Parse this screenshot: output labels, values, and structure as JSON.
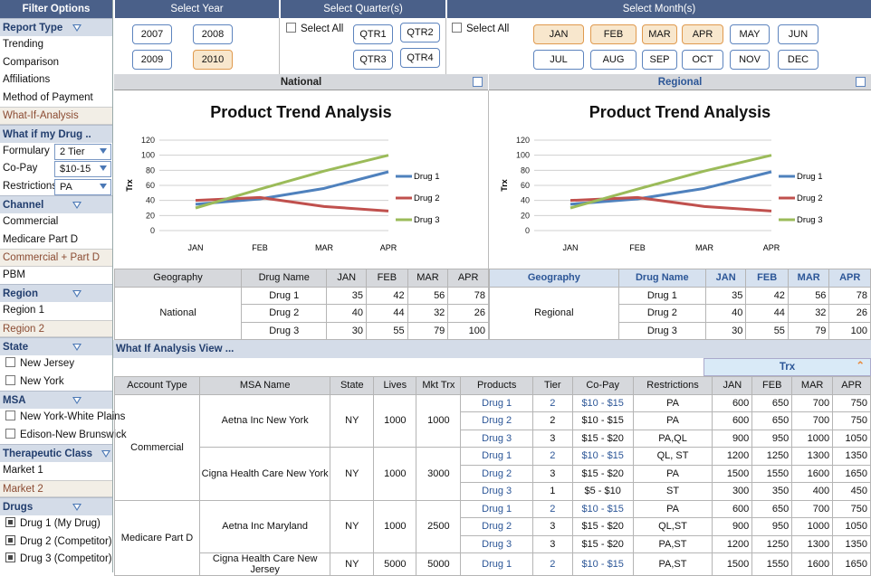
{
  "sidebar": {
    "title": "Filter Options",
    "report_type": {
      "header": "Report Type",
      "items": [
        "Trending",
        "Comparison",
        "Affiliations",
        "Method of Payment",
        "What-If-Analysis"
      ]
    },
    "what_if": {
      "header": "What if my Drug ..",
      "rows": [
        {
          "label": "Formulary",
          "value": "2 Tier"
        },
        {
          "label": "Co-Pay",
          "value": "$10-15"
        },
        {
          "label": "Restrictions",
          "value": "PA"
        }
      ]
    },
    "channel": {
      "header": "Channel",
      "items": [
        "Commercial",
        "Medicare Part D",
        "Commercial + Part D",
        "PBM"
      ]
    },
    "region": {
      "header": "Region",
      "items": [
        "Region 1",
        "Region 2"
      ]
    },
    "state": {
      "header": "State",
      "items": [
        "New Jersey",
        "New York"
      ]
    },
    "msa": {
      "header": "MSA",
      "items": [
        "New York-White Plains",
        "Edison-New Brunswick"
      ]
    },
    "therapeutic": {
      "header": "Therapeutic Class",
      "items": [
        "Market 1",
        "Market 2"
      ]
    },
    "drugs": {
      "header": "Drugs",
      "items": [
        "Drug 1 (My Drug)",
        "Drug 2 (Competitor)",
        "Drug 3 (Competitor)"
      ]
    }
  },
  "filters": {
    "year": {
      "header": "Select Year",
      "options": [
        "2007",
        "2008",
        "2009",
        "2010"
      ],
      "selected": "2010"
    },
    "quarter": {
      "header": "Select Quarter(s)",
      "select_all": "Select All",
      "options": [
        "QTR1",
        "QTR2",
        "QTR3",
        "QTR4"
      ]
    },
    "month": {
      "header": "Select Month(s)",
      "select_all": "Select All",
      "options": [
        "JAN",
        "FEB",
        "MAR",
        "APR",
        "MAY",
        "JUN",
        "JUL",
        "AUG",
        "SEP",
        "OCT",
        "NOV",
        "DEC"
      ],
      "selected": [
        "JAN",
        "FEB",
        "MAR",
        "APR"
      ]
    }
  },
  "panels": {
    "national": "National",
    "regional": "Regional"
  },
  "chart_data": [
    {
      "type": "line",
      "title": "Product Trend Analysis",
      "ylabel": "Trx",
      "xlabel": "",
      "categories": [
        "JAN",
        "FEB",
        "MAR",
        "APR"
      ],
      "ylim": [
        0,
        120
      ],
      "yticks": [
        0,
        20,
        40,
        60,
        80,
        100,
        120
      ],
      "grid": true,
      "legend": "right",
      "series": [
        {
          "name": "Drug 1",
          "values": [
            35,
            42,
            56,
            78
          ],
          "color": "#4f81bd"
        },
        {
          "name": "Drug 2",
          "values": [
            40,
            44,
            32,
            26
          ],
          "color": "#c0504d"
        },
        {
          "name": "Drug 3",
          "values": [
            30,
            55,
            79,
            100
          ],
          "color": "#9bbb59"
        }
      ]
    },
    {
      "type": "line",
      "title": "Product Trend Analysis",
      "ylabel": "Trx",
      "xlabel": "",
      "categories": [
        "JAN",
        "FEB",
        "MAR",
        "APR"
      ],
      "ylim": [
        0,
        120
      ],
      "yticks": [
        0,
        20,
        40,
        60,
        80,
        100,
        120
      ],
      "grid": true,
      "legend": "right",
      "series": [
        {
          "name": "Drug 1",
          "values": [
            35,
            42,
            56,
            78
          ],
          "color": "#4f81bd"
        },
        {
          "name": "Drug 2",
          "values": [
            40,
            44,
            32,
            26
          ],
          "color": "#c0504d"
        },
        {
          "name": "Drug 3",
          "values": [
            30,
            55,
            79,
            100
          ],
          "color": "#9bbb59"
        }
      ]
    }
  ],
  "summary": {
    "headers": [
      "Geography",
      "Drug Name",
      "JAN",
      "FEB",
      "MAR",
      "APR"
    ],
    "national": {
      "geo": "National",
      "rows": [
        [
          "Drug 1",
          "35",
          "42",
          "56",
          "78"
        ],
        [
          "Drug 2",
          "40",
          "44",
          "32",
          "26"
        ],
        [
          "Drug 3",
          "30",
          "55",
          "79",
          "100"
        ]
      ]
    },
    "regional": {
      "geo": "Regional",
      "rows": [
        [
          "Drug 1",
          "35",
          "42",
          "56",
          "78"
        ],
        [
          "Drug 2",
          "40",
          "44",
          "32",
          "26"
        ],
        [
          "Drug 3",
          "30",
          "55",
          "79",
          "100"
        ]
      ]
    }
  },
  "whatif": {
    "title": "What If Analysis View ...",
    "trx": "Trx",
    "headers": [
      "Account Type",
      "MSA Name",
      "State",
      "Lives",
      "Mkt Trx",
      "Products",
      "Tier",
      "Co-Pay",
      "Restrictions",
      "JAN",
      "FEB",
      "MAR",
      "APR"
    ],
    "groups": [
      {
        "account": "Commercial",
        "msas": [
          {
            "name": "Aetna Inc New York",
            "state": "NY",
            "lives": "1000",
            "mkt": "1000",
            "rows": [
              [
                "Drug 1",
                "2",
                "$10 - $15",
                "PA",
                "600",
                "650",
                "700",
                "750"
              ],
              [
                "Drug 2",
                "2",
                "$10 - $15",
                "PA",
                "600",
                "650",
                "700",
                "750"
              ],
              [
                "Drug 3",
                "3",
                "$15 - $20",
                "PA,QL",
                "900",
                "950",
                "1000",
                "1050"
              ]
            ]
          },
          {
            "name": "Cigna Health Care New York",
            "state": "NY",
            "lives": "1000",
            "mkt": "3000",
            "rows": [
              [
                "Drug 1",
                "2",
                "$10 - $15",
                "QL, ST",
                "1200",
                "1250",
                "1300",
                "1350"
              ],
              [
                "Drug 2",
                "3",
                "$15 - $20",
                "PA",
                "1500",
                "1550",
                "1600",
                "1650"
              ],
              [
                "Drug 3",
                "1",
                "$5 - $10",
                "ST",
                "300",
                "350",
                "400",
                "450"
              ]
            ]
          }
        ]
      },
      {
        "account": "Medicare Part D",
        "msas": [
          {
            "name": "Aetna Inc Maryland",
            "state": "NY",
            "lives": "1000",
            "mkt": "2500",
            "rows": [
              [
                "Drug 1",
                "2",
                "$10 - $15",
                "PA",
                "600",
                "650",
                "700",
                "750"
              ],
              [
                "Drug 2",
                "3",
                "$15 - $20",
                "QL,ST",
                "900",
                "950",
                "1000",
                "1050"
              ],
              [
                "Drug 3",
                "3",
                "$15 - $20",
                "PA,ST",
                "1200",
                "1250",
                "1300",
                "1350"
              ]
            ]
          },
          {
            "name": "Cigna Health Care New Jersey",
            "state": "NY",
            "lives": "5000",
            "mkt": "5000",
            "rows": [
              [
                "Drug 1",
                "2",
                "$10 - $15",
                "PA,ST",
                "1500",
                "1550",
                "1600",
                "1650"
              ]
            ]
          }
        ]
      }
    ]
  }
}
